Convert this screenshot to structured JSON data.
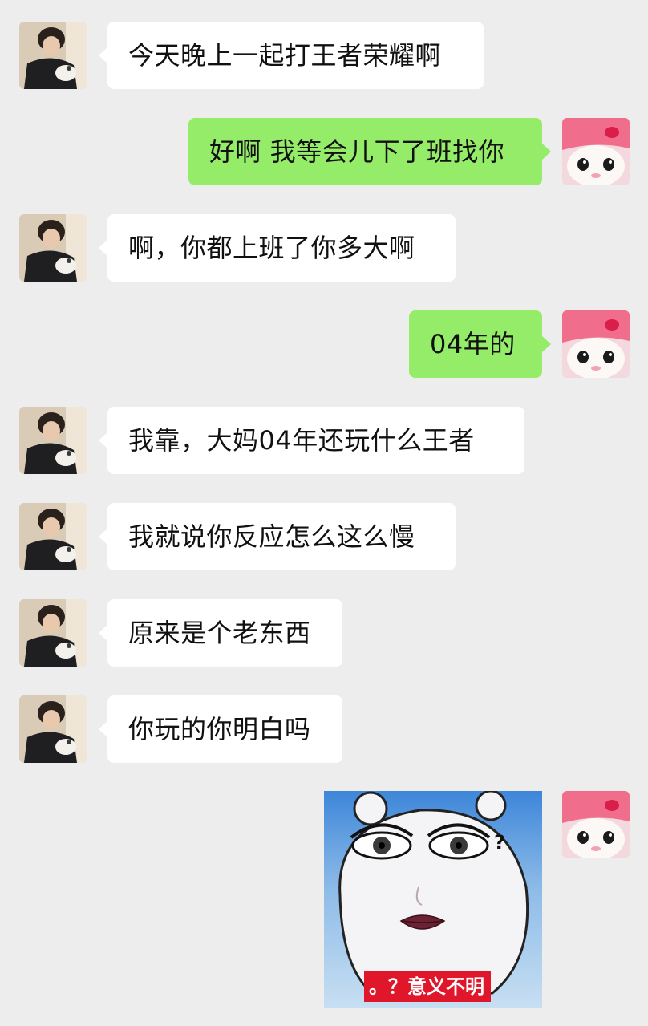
{
  "messages": [
    {
      "sender": "friend",
      "text": "今天晚上一起打王者荣耀啊"
    },
    {
      "sender": "me",
      "text": "好啊 我等会儿下了班找你"
    },
    {
      "sender": "friend",
      "text": "啊，你都上班了你多大啊"
    },
    {
      "sender": "me",
      "text": "04年的"
    },
    {
      "sender": "friend",
      "text": "我靠，大妈04年还玩什么王者"
    },
    {
      "sender": "friend",
      "text": "我就说你反应怎么这么慢"
    },
    {
      "sender": "friend",
      "text": "原来是个老东西"
    },
    {
      "sender": "friend",
      "text": "你玩的你明白吗"
    }
  ],
  "sticker": {
    "caption": "。？意义不明",
    "question_mark": "?"
  },
  "colors": {
    "background": "#ededed",
    "incoming_bubble": "#ffffff",
    "outgoing_bubble": "#95ec69",
    "sticker_caption_bg": "#e0162b"
  }
}
